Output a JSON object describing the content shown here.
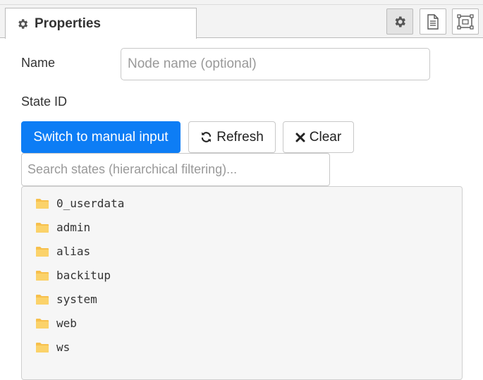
{
  "header": {
    "tab_label": "Properties",
    "tools": [
      {
        "name": "settings",
        "icon": "gear-icon",
        "active": true
      },
      {
        "name": "description",
        "icon": "document-icon",
        "active": false
      },
      {
        "name": "appearance",
        "icon": "frame-icon",
        "active": false
      }
    ]
  },
  "form": {
    "name_label": "Name",
    "name_value": "",
    "name_placeholder": "Node name (optional)",
    "state_id_label": "State ID"
  },
  "buttons": {
    "manual_input": "Switch to manual input",
    "refresh": "Refresh",
    "clear": "Clear"
  },
  "search": {
    "value": "",
    "placeholder": "Search states (hierarchical filtering)..."
  },
  "tree": {
    "items": [
      {
        "label": "0_userdata",
        "icon": "folder-icon"
      },
      {
        "label": "admin",
        "icon": "folder-icon"
      },
      {
        "label": "alias",
        "icon": "folder-icon"
      },
      {
        "label": "backitup",
        "icon": "folder-icon"
      },
      {
        "label": "system",
        "icon": "folder-icon"
      },
      {
        "label": "web",
        "icon": "folder-icon"
      },
      {
        "label": "ws",
        "icon": "folder-icon"
      }
    ]
  },
  "colors": {
    "primary": "#0d7df5",
    "folder": "#f7c04c",
    "tree_background": "#f6f6f6"
  }
}
